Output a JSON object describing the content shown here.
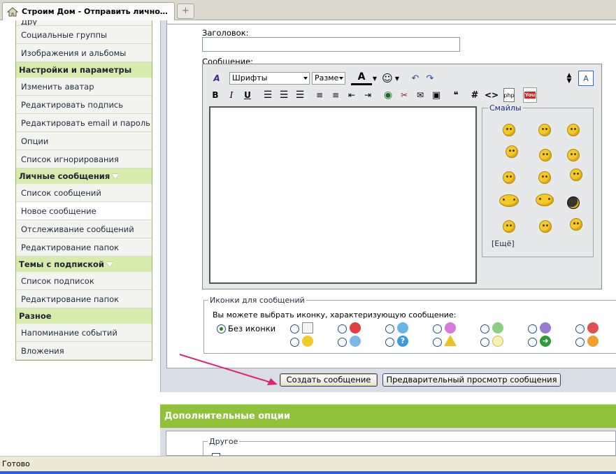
{
  "tab": {
    "title": "Строим Дом - Отправить личное со...",
    "new_tab": "+"
  },
  "sidebar": {
    "top_partial": "Дру",
    "items_a": [
      "Социальные группы",
      "Изображения и альбомы"
    ],
    "heading_settings": "Настройки и параметры",
    "items_settings": [
      "Изменить аватар",
      "Редактировать подпись",
      "Редактировать email и пароль",
      "Опции",
      "Список игнорирования"
    ],
    "heading_pm": "Личные сообщения",
    "items_pm": [
      "Список сообщений",
      "Новое сообщение",
      "Отслеживание сообщений",
      "Редактирование папок"
    ],
    "heading_subs": "Темы с подпиской",
    "items_subs": [
      "Список подписок",
      "Редактирование папок"
    ],
    "heading_misc": "Разное",
    "items_misc": [
      "Напоминание событий",
      "Вложения"
    ]
  },
  "form": {
    "title_label": "Заголовок:",
    "title_value": "",
    "message_label": "Сообщение:",
    "font_select": "Шрифты",
    "size_select": "Разме",
    "smilies_legend": "Смайлы",
    "smilies_more": "[Ещё]",
    "icons_legend": "Иконки для сообщений",
    "icons_prompt": "Вы можете выбрать иконку, характеризующую сообщение:",
    "no_icon_label": "Без иконки",
    "submit_button": "Создать сообщение",
    "preview_button": "Предварительный просмотр сообщения"
  },
  "extra": {
    "heading": "Дополнительные опции",
    "other_legend": "Другое"
  },
  "status": {
    "text": "Готово"
  },
  "colors": {
    "accent_green": "#8fc238",
    "sidebar_head": "#d6ecad",
    "arrow": "#e0207a"
  }
}
